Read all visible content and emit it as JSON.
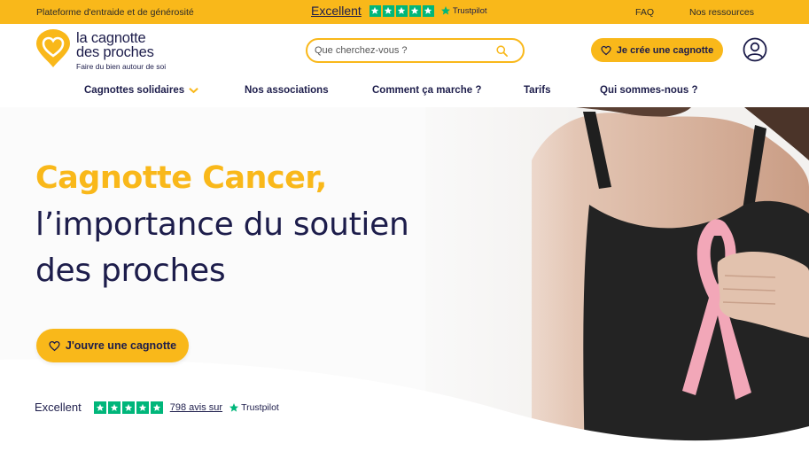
{
  "topbar": {
    "tagline": "Plateforme d'entraide et de générosité",
    "trustpilot_rating": "Excellent",
    "trustpilot_brand": "Trustpilot",
    "faq": "FAQ",
    "resources": "Nos ressources",
    "color": "#f9b81a"
  },
  "logo": {
    "line1": "la cagnotte",
    "line2": "des proches",
    "baseline": "Faire du bien autour de soi"
  },
  "search": {
    "placeholder": "Que cherchez-vous ?",
    "icon": "search-icon"
  },
  "header": {
    "create_button": "Je crée une cagnotte",
    "account_icon": "user-icon"
  },
  "nav": {
    "items": [
      {
        "label": "Cagnottes solidaires",
        "has_dropdown": true
      },
      {
        "label": "Nos associations"
      },
      {
        "label": "Comment ça marche ?"
      },
      {
        "label": "Tarifs"
      },
      {
        "label": "Qui sommes-nous ?"
      }
    ]
  },
  "hero": {
    "title_highlight": "Cagnotte Cancer,",
    "title_line2": "l’importance du soutien",
    "title_line3": "des proches",
    "cta": "J'ouvre une cagnotte",
    "trust_rating": "Excellent",
    "trust_reviews": "798 avis sur",
    "trust_brand": "Trustpilot",
    "stars": 5
  },
  "colors": {
    "brand_yellow": "#f9b81a",
    "navy": "#1d1d4b",
    "trustpilot_green": "#00b67a"
  }
}
